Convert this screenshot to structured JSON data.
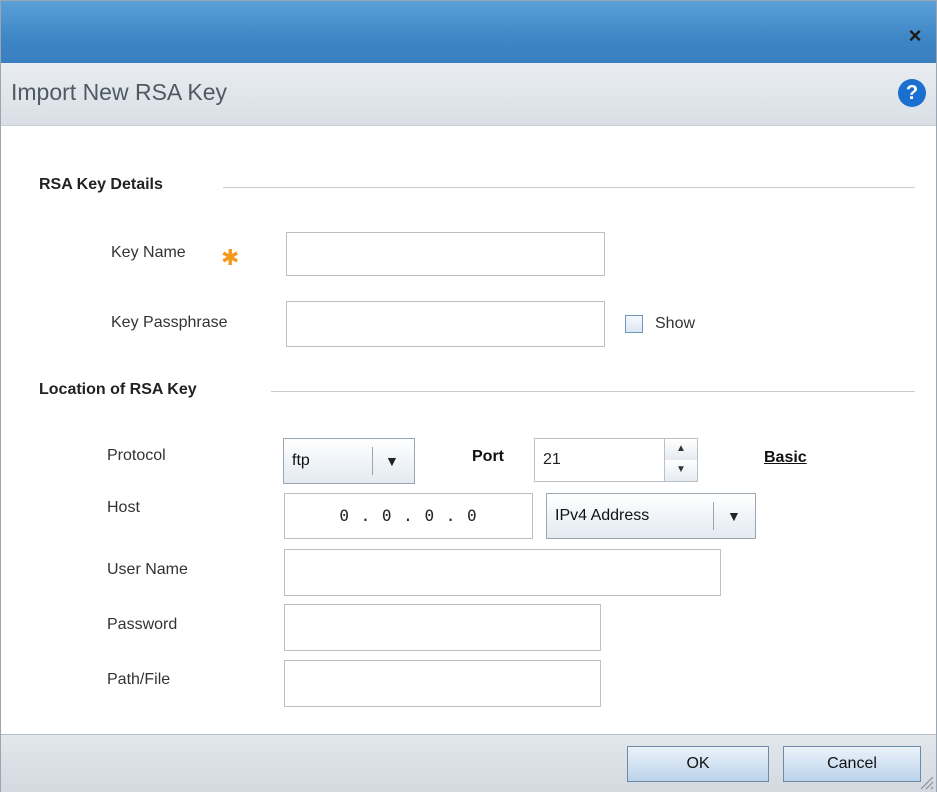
{
  "dialog": {
    "title": "Import New RSA Key",
    "close_label": "×",
    "help_label": "?"
  },
  "section_details": {
    "title": "RSA Key Details",
    "key_name_label": "Key Name",
    "key_name_value": "",
    "key_passphrase_label": "Key Passphrase",
    "key_passphrase_value": "",
    "show_label": "Show",
    "show_checked": false
  },
  "section_location": {
    "title": "Location of RSA Key",
    "protocol_label": "Protocol",
    "protocol_value": "ftp",
    "port_label": "Port",
    "port_value": "21",
    "basic_link": "Basic",
    "host_label": "Host",
    "host_value": "0 .  0 .  0 .  0",
    "host_type_value": "IPv4 Address",
    "user_name_label": "User Name",
    "user_name_value": "",
    "password_label": "Password",
    "password_value": "",
    "path_label": "Path/File",
    "path_value": ""
  },
  "footer": {
    "ok_label": "OK",
    "cancel_label": "Cancel"
  },
  "colors": {
    "titlebar": "#3f86c6",
    "help_icon": "#1a6fcf",
    "required_star": "#f39a1e"
  },
  "icons": {
    "close": "close-icon",
    "help": "help-icon",
    "required": "required-star-icon",
    "dropdown": "chevron-down-icon"
  }
}
